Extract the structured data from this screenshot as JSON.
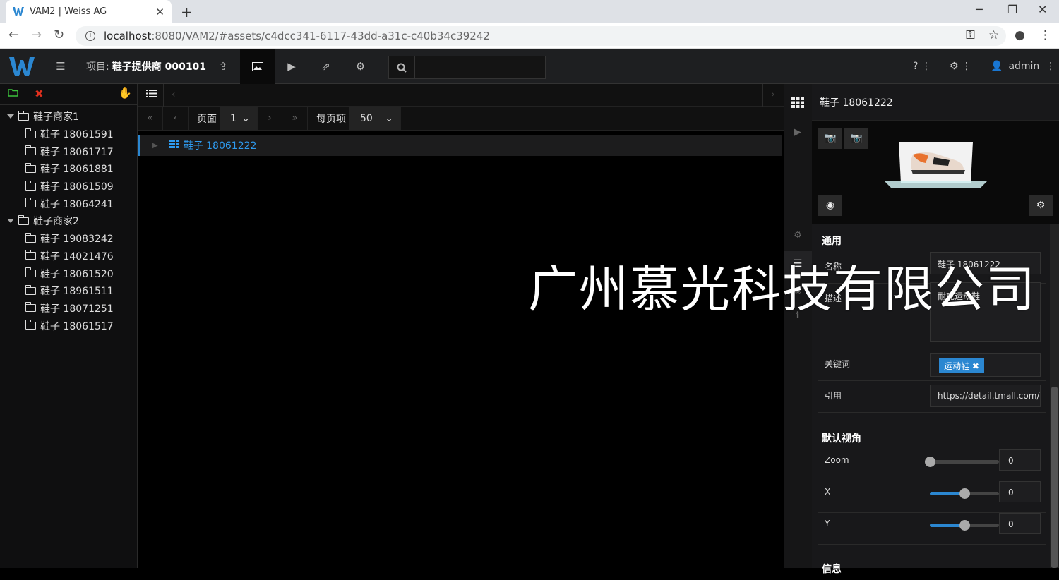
{
  "browser": {
    "tab_title": "VAM2 | Weiss AG",
    "url_host": "localhost",
    "url_rest": ":8080/VAM2/#assets/c4dcc341-6117-43dd-a31c-c40b34c39242"
  },
  "appbar": {
    "project_label": "项目:",
    "project_name": "鞋子提供商 000101",
    "help": "?",
    "user": "admin"
  },
  "tree": [
    {
      "label": "鞋子商家1",
      "children": [
        "鞋子 18061591",
        "鞋子 18061717",
        "鞋子 18061881",
        "鞋子 18061509",
        "鞋子 18064241"
      ]
    },
    {
      "label": "鞋子商家2",
      "children": [
        "鞋子 19083242",
        "鞋子 14021476",
        "鞋子 18061520",
        "鞋子 18961511",
        "鞋子 18071251",
        "鞋子 18061517"
      ]
    }
  ],
  "pager": {
    "page_label": "页面",
    "page_value": "1",
    "per_page_label": "每页项",
    "per_page_value": "50"
  },
  "list": {
    "row_label": "鞋子 18061222"
  },
  "detail": {
    "title": "鞋子 18061222",
    "section_general": "通用",
    "name_label": "名称",
    "name_value": "鞋子 18061222",
    "desc_label": "描述",
    "desc_value": "耐克运动鞋",
    "keywords_label": "关键词",
    "keyword_tag": "运动鞋",
    "ref_label": "引用",
    "ref_value": "https://detail.tmall.com/ite",
    "section_view": "默认视角",
    "zoom_label": "Zoom",
    "zoom_value": "0",
    "zoom_level": 0.0,
    "x_label": "X",
    "x_value": "0",
    "x_level": 0.5,
    "y_label": "Y",
    "y_value": "0",
    "y_level": 0.5,
    "section_info": "信息"
  },
  "watermark": "广州慕光科技有限公司",
  "colors": {
    "accent": "#2b87d1",
    "link": "#2e9bf0",
    "delete": "#e0301e",
    "add": "#3cc13c"
  }
}
